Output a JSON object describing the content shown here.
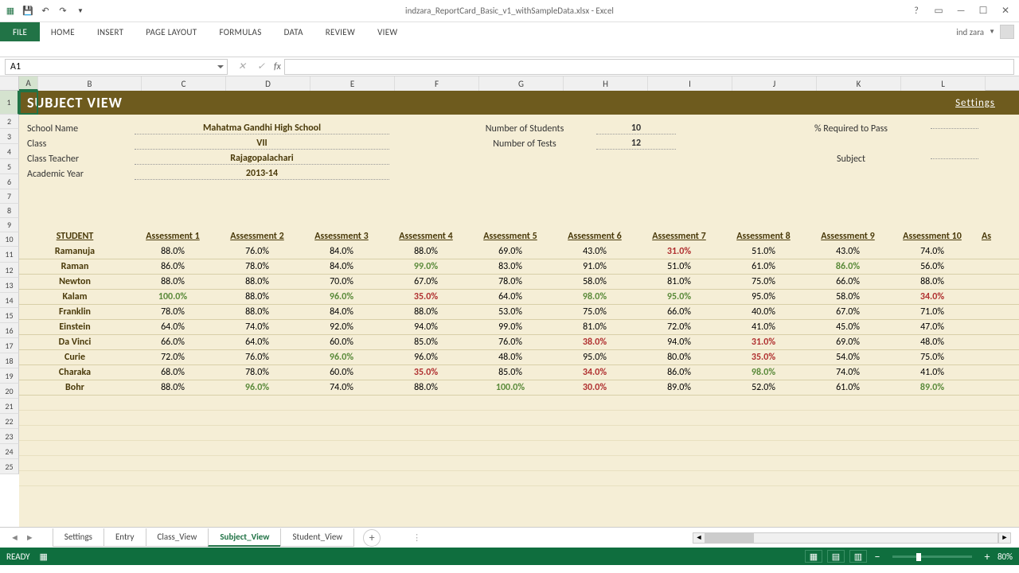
{
  "window": {
    "title": "indzara_ReportCard_Basic_v1_withSampleData.xlsx - Excel"
  },
  "ribbon": {
    "file": "FILE",
    "tabs": [
      "HOME",
      "INSERT",
      "PAGE LAYOUT",
      "FORMULAS",
      "DATA",
      "REVIEW",
      "VIEW"
    ],
    "user": "ind zara"
  },
  "formula": {
    "nameBox": "A1"
  },
  "columns": [
    "A",
    "B",
    "C",
    "D",
    "E",
    "F",
    "G",
    "H",
    "I",
    "J",
    "K",
    "L"
  ],
  "rows": [
    "1",
    "2",
    "3",
    "4",
    "5",
    "6",
    "7",
    "8",
    "9",
    "10",
    "11",
    "12",
    "13",
    "14",
    "15",
    "16",
    "17",
    "18",
    "19",
    "20",
    "21",
    "22",
    "23",
    "24",
    "25"
  ],
  "sheet": {
    "title": "SUBJECT VIEW",
    "settingsLink": "Settings",
    "info": {
      "schoolLabel": "School Name",
      "school": "Mahatma Gandhi High School",
      "classLabel": "Class",
      "class": "VII",
      "teacherLabel": "Class Teacher",
      "teacher": "Rajagopalachari",
      "yearLabel": "Academic Year",
      "year": "2013-14",
      "numStudentsLabel": "Number of Students",
      "numStudents": "10",
      "numTestsLabel": "Number of Tests",
      "numTests": "12",
      "pctPassLabel": "% Required to Pass",
      "subjectLabel": "Subject"
    },
    "headers": [
      "STUDENT",
      "Assessment 1",
      "Assessment 2",
      "Assessment 3",
      "Assessment 4",
      "Assessment 5",
      "Assessment 6",
      "Assessment 7",
      "Assessment 8",
      "Assessment 9",
      "Assessment 10",
      "As"
    ],
    "students": [
      {
        "name": "Ramanuja",
        "v": [
          {
            "t": "88.0%"
          },
          {
            "t": "76.0%"
          },
          {
            "t": "84.0%"
          },
          {
            "t": "88.0%"
          },
          {
            "t": "69.0%"
          },
          {
            "t": "43.0%"
          },
          {
            "t": "31.0%",
            "c": "red"
          },
          {
            "t": "51.0%"
          },
          {
            "t": "43.0%"
          },
          {
            "t": "74.0%"
          }
        ]
      },
      {
        "name": "Raman",
        "v": [
          {
            "t": "86.0%"
          },
          {
            "t": "78.0%"
          },
          {
            "t": "84.0%"
          },
          {
            "t": "99.0%",
            "c": "green"
          },
          {
            "t": "83.0%"
          },
          {
            "t": "91.0%"
          },
          {
            "t": "51.0%"
          },
          {
            "t": "61.0%"
          },
          {
            "t": "86.0%",
            "c": "green"
          },
          {
            "t": "56.0%"
          }
        ]
      },
      {
        "name": "Newton",
        "v": [
          {
            "t": "88.0%"
          },
          {
            "t": "88.0%"
          },
          {
            "t": "70.0%"
          },
          {
            "t": "67.0%"
          },
          {
            "t": "78.0%"
          },
          {
            "t": "58.0%"
          },
          {
            "t": "81.0%"
          },
          {
            "t": "75.0%"
          },
          {
            "t": "66.0%"
          },
          {
            "t": "88.0%"
          }
        ]
      },
      {
        "name": "Kalam",
        "v": [
          {
            "t": "100.0%",
            "c": "green"
          },
          {
            "t": "88.0%"
          },
          {
            "t": "96.0%",
            "c": "green"
          },
          {
            "t": "35.0%",
            "c": "red"
          },
          {
            "t": "64.0%"
          },
          {
            "t": "98.0%",
            "c": "green"
          },
          {
            "t": "95.0%",
            "c": "green"
          },
          {
            "t": "95.0%"
          },
          {
            "t": "58.0%"
          },
          {
            "t": "34.0%",
            "c": "red"
          }
        ]
      },
      {
        "name": "Franklin",
        "v": [
          {
            "t": "78.0%"
          },
          {
            "t": "88.0%"
          },
          {
            "t": "84.0%"
          },
          {
            "t": "88.0%"
          },
          {
            "t": "53.0%"
          },
          {
            "t": "75.0%"
          },
          {
            "t": "66.0%"
          },
          {
            "t": "40.0%"
          },
          {
            "t": "67.0%"
          },
          {
            "t": "71.0%"
          }
        ]
      },
      {
        "name": "Einstein",
        "v": [
          {
            "t": "64.0%"
          },
          {
            "t": "74.0%"
          },
          {
            "t": "92.0%"
          },
          {
            "t": "94.0%"
          },
          {
            "t": "99.0%"
          },
          {
            "t": "81.0%"
          },
          {
            "t": "72.0%"
          },
          {
            "t": "41.0%"
          },
          {
            "t": "45.0%"
          },
          {
            "t": "47.0%"
          }
        ]
      },
      {
        "name": "Da Vinci",
        "v": [
          {
            "t": "66.0%"
          },
          {
            "t": "64.0%"
          },
          {
            "t": "60.0%"
          },
          {
            "t": "85.0%"
          },
          {
            "t": "76.0%"
          },
          {
            "t": "38.0%",
            "c": "red"
          },
          {
            "t": "94.0%"
          },
          {
            "t": "31.0%",
            "c": "red"
          },
          {
            "t": "69.0%"
          },
          {
            "t": "48.0%"
          }
        ]
      },
      {
        "name": "Curie",
        "v": [
          {
            "t": "72.0%"
          },
          {
            "t": "76.0%"
          },
          {
            "t": "96.0%",
            "c": "green"
          },
          {
            "t": "96.0%"
          },
          {
            "t": "48.0%"
          },
          {
            "t": "95.0%"
          },
          {
            "t": "80.0%"
          },
          {
            "t": "35.0%",
            "c": "red"
          },
          {
            "t": "54.0%"
          },
          {
            "t": "75.0%"
          }
        ]
      },
      {
        "name": "Charaka",
        "v": [
          {
            "t": "68.0%"
          },
          {
            "t": "78.0%"
          },
          {
            "t": "60.0%"
          },
          {
            "t": "35.0%",
            "c": "red"
          },
          {
            "t": "85.0%"
          },
          {
            "t": "34.0%",
            "c": "red"
          },
          {
            "t": "86.0%"
          },
          {
            "t": "98.0%",
            "c": "green"
          },
          {
            "t": "74.0%"
          },
          {
            "t": "41.0%"
          }
        ]
      },
      {
        "name": "Bohr",
        "v": [
          {
            "t": "88.0%"
          },
          {
            "t": "96.0%",
            "c": "green"
          },
          {
            "t": "74.0%"
          },
          {
            "t": "88.0%"
          },
          {
            "t": "100.0%",
            "c": "green"
          },
          {
            "t": "30.0%",
            "c": "red"
          },
          {
            "t": "89.0%"
          },
          {
            "t": "52.0%"
          },
          {
            "t": "61.0%"
          },
          {
            "t": "89.0%",
            "c": "green"
          }
        ]
      }
    ]
  },
  "tabs": {
    "list": [
      "Settings",
      "Entry",
      "Class_View",
      "Subject_View",
      "Student_View"
    ],
    "active": "Subject_View"
  },
  "status": {
    "ready": "READY",
    "zoom": "80%"
  }
}
